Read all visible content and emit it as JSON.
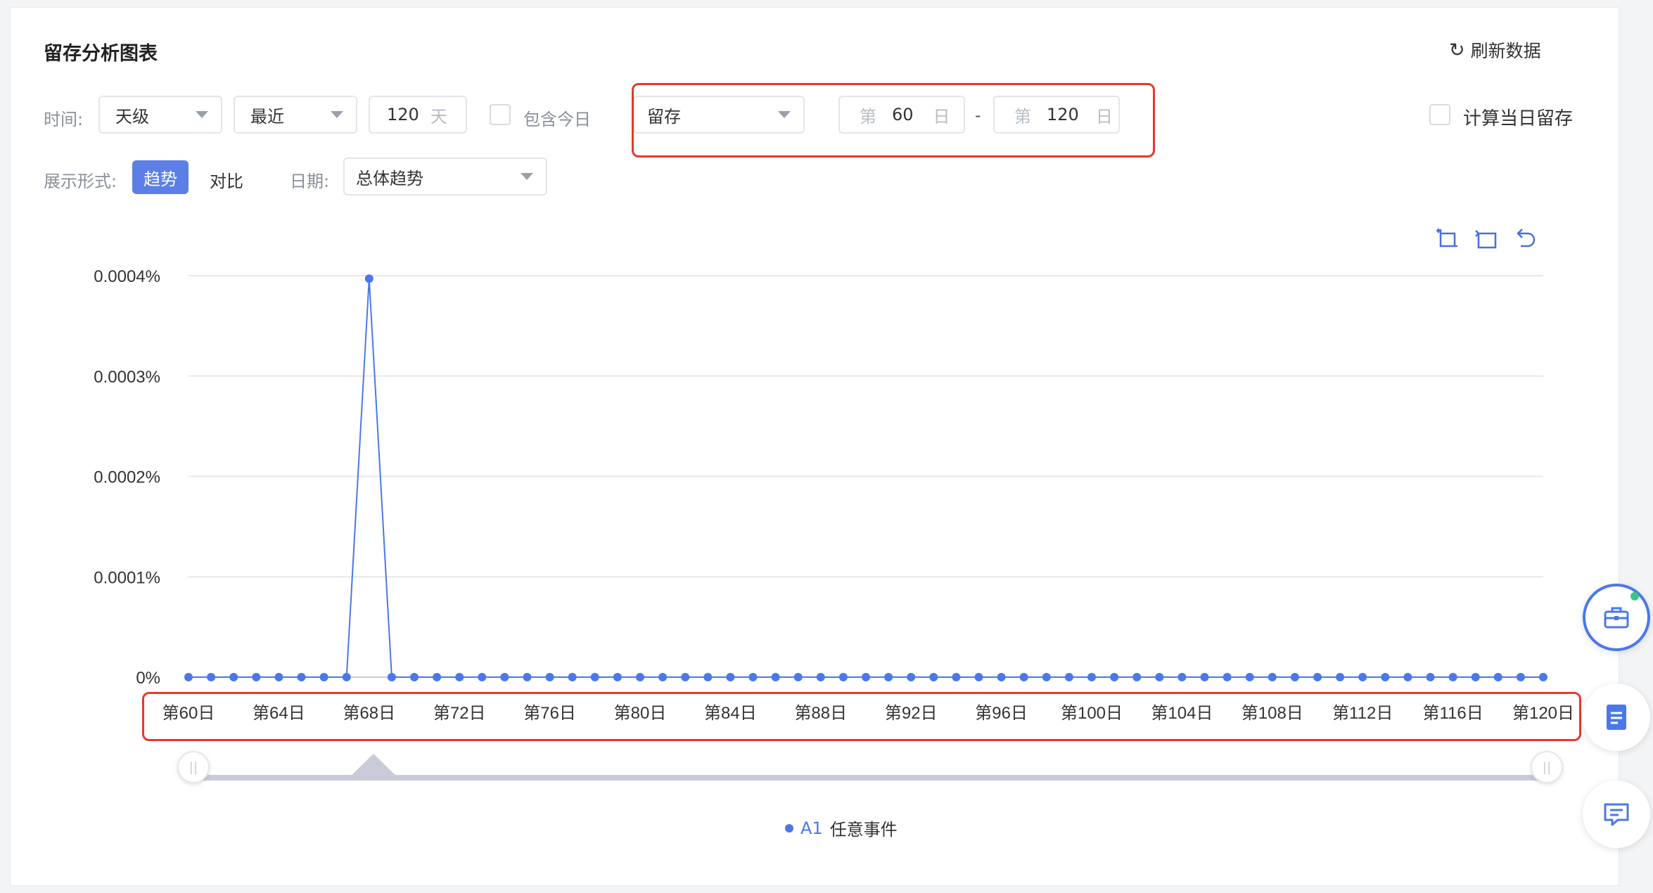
{
  "header": {
    "title": "留存分析图表",
    "refresh_label": "刷新数据",
    "refresh_icon": "refresh-icon"
  },
  "filters": {
    "time_label": "时间:",
    "granularity": "天级",
    "range_mode": "最近",
    "days_value": "120",
    "days_unit": "天",
    "include_today_label": "包含今日",
    "metric": "留存",
    "range_prefix": "第",
    "range_start": "60",
    "range_suffix": "日",
    "range_sep": "-",
    "range_end": "120",
    "calc_same_day_label": "计算当日留存"
  },
  "display": {
    "display_label": "展示形式:",
    "trend_label": "趋势",
    "compare_label": "对比",
    "date_label": "日期:",
    "date_value": "总体趋势"
  },
  "toolbar": {
    "icons": [
      "zoom-select-icon",
      "zoom-reset-icon",
      "undo-icon"
    ]
  },
  "chart_data": {
    "type": "line",
    "x": [
      "第60日",
      "第61日",
      "第62日",
      "第63日",
      "第64日",
      "第65日",
      "第66日",
      "第67日",
      "第68日",
      "第69日",
      "第70日",
      "第71日",
      "第72日",
      "第73日",
      "第74日",
      "第75日",
      "第76日",
      "第77日",
      "第78日",
      "第79日",
      "第80日",
      "第81日",
      "第82日",
      "第83日",
      "第84日",
      "第85日",
      "第86日",
      "第87日",
      "第88日",
      "第89日",
      "第90日",
      "第91日",
      "第92日",
      "第93日",
      "第94日",
      "第95日",
      "第96日",
      "第97日",
      "第98日",
      "第99日",
      "第100日",
      "第101日",
      "第102日",
      "第103日",
      "第104日",
      "第105日",
      "第106日",
      "第107日",
      "第108日",
      "第109日",
      "第110日",
      "第111日",
      "第112日",
      "第113日",
      "第114日",
      "第115日",
      "第116日",
      "第117日",
      "第118日",
      "第119日",
      "第120日"
    ],
    "xticks": [
      "第60日",
      "第64日",
      "第68日",
      "第72日",
      "第76日",
      "第80日",
      "第84日",
      "第88日",
      "第92日",
      "第96日",
      "第100日",
      "第104日",
      "第108日",
      "第112日",
      "第116日",
      "第120日"
    ],
    "yticks": [
      "0.0004%",
      "0.0003%",
      "0.0002%",
      "0.0001%",
      "0%"
    ],
    "ylim": [
      0,
      0.0004
    ],
    "series": [
      {
        "name": "A1 任意事件",
        "color": "#4a78e8",
        "values": [
          0,
          0,
          0,
          0,
          0,
          0,
          0,
          0,
          0.000397,
          0,
          0,
          0,
          0,
          0,
          0,
          0,
          0,
          0,
          0,
          0,
          0,
          0,
          0,
          0,
          0,
          0,
          0,
          0,
          0,
          0,
          0,
          0,
          0,
          0,
          0,
          0,
          0,
          0,
          0,
          0,
          0,
          0,
          0,
          0,
          0,
          0,
          0,
          0,
          0,
          0,
          0,
          0,
          0,
          0,
          0,
          0,
          0,
          0,
          0,
          0,
          0
        ]
      }
    ],
    "grid": true
  },
  "legend": {
    "series_id": "A1",
    "series_label": "任意事件"
  },
  "side_buttons": [
    "toolbox-icon",
    "document-icon",
    "feedback-icon"
  ]
}
